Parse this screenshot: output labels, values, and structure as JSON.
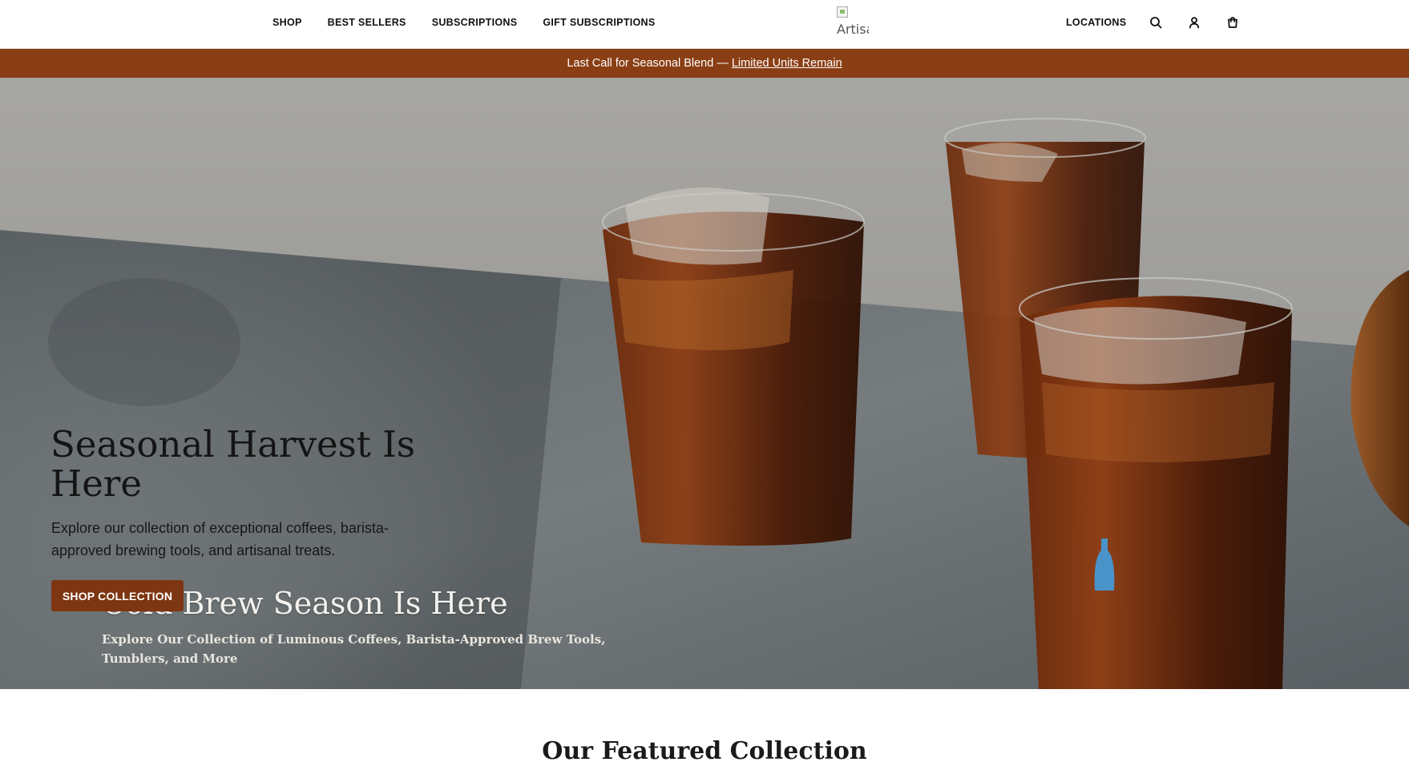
{
  "header": {
    "nav_left": [
      {
        "label": "SHOP"
      },
      {
        "label": "BEST SELLERS"
      },
      {
        "label": "SUBSCRIPTIONS"
      },
      {
        "label": "GIFT SUBSCRIPTIONS"
      }
    ],
    "logo_alt": "Artisa",
    "nav_right": {
      "locations_label": "LOCATIONS",
      "icons": [
        "search-icon",
        "account-icon",
        "cart-icon"
      ]
    }
  },
  "announcement": {
    "text": "Last Call for Seasonal Blend —",
    "link": "Limited Units Remain",
    "bg_color": "#8a3e14"
  },
  "hero": {
    "title": "Seasonal Harvest Is Here",
    "description": "Explore our collection of exceptional coffees, barista-approved brewing tools, and artisanal treats.",
    "button_label": "SHOP COLLECTION",
    "button_color": "#7d3611",
    "image_overlay_title": "Cold Brew Season Is Here",
    "image_overlay_text": "Explore Our Collection of Luminous Coffees, Barista-Approved Brew Tools, Tumblers, and More"
  },
  "featured": {
    "title": "Our Featured Collection"
  }
}
